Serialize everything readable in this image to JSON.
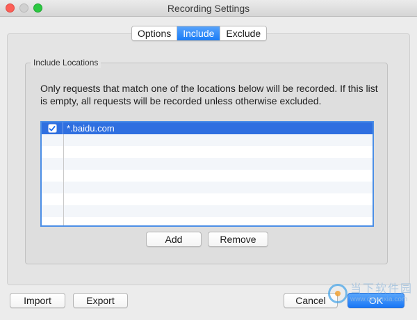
{
  "window": {
    "title": "Recording Settings"
  },
  "tabs": [
    {
      "label": "Options",
      "active": false
    },
    {
      "label": "Include",
      "active": true
    },
    {
      "label": "Exclude",
      "active": false
    }
  ],
  "include": {
    "group_title": "Include Locations",
    "description": "Only requests that match one of the locations below will be recorded. If this list is empty, all requests will be recorded unless otherwise excluded.",
    "locations": [
      {
        "enabled": true,
        "location": "*.baidu.com"
      }
    ],
    "add_label": "Add",
    "remove_label": "Remove"
  },
  "footer": {
    "import_label": "Import",
    "export_label": "Export",
    "cancel_label": "Cancel",
    "ok_label": "OK"
  },
  "watermark": {
    "text_cn": "当下软件园",
    "url": "www.downxia.com"
  },
  "colors": {
    "accent": "#1a7cf6",
    "selection": "#2f6fe0"
  }
}
